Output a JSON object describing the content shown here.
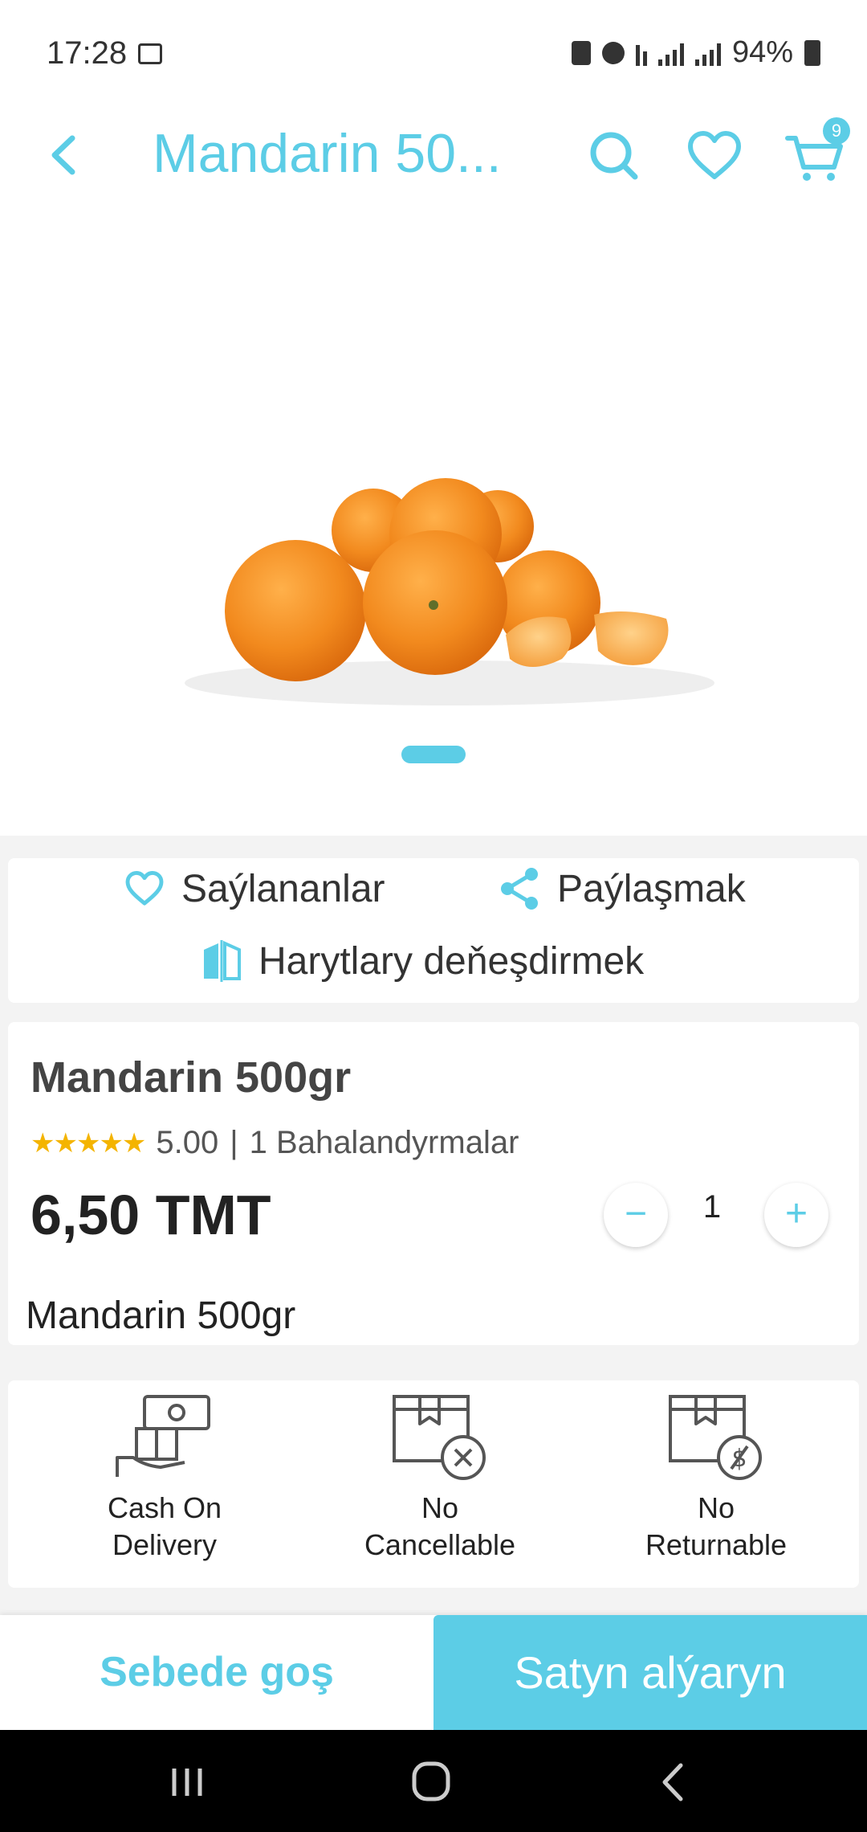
{
  "status_bar": {
    "time": "17:28",
    "battery": "94%"
  },
  "header": {
    "title": "Mandarin 50...",
    "cart_count": "9",
    "accent_color": "#5ccde6"
  },
  "actions": {
    "favorites_label": "Saýlananlar",
    "share_label": "Paýlaşmak",
    "compare_label": "Harytlary deňeşdirmek"
  },
  "product": {
    "name": "Mandarin 500gr",
    "stars": "★★★★★",
    "rating": "5.00",
    "rating_separator": "|",
    "reviews_text": "1 Bahalandyrmalar",
    "price": "6,50 TMT",
    "quantity": "1",
    "minus_symbol": "−",
    "plus_symbol": "+",
    "description": "Mandarin 500gr"
  },
  "policies": [
    {
      "icon": "cash-on-delivery-icon",
      "line1": "Cash On",
      "line2": "Delivery"
    },
    {
      "icon": "no-cancel-box-icon",
      "line1": "No",
      "line2": "Cancellable"
    },
    {
      "icon": "no-return-box-icon",
      "line1": "No",
      "line2": "Returnable"
    }
  ],
  "bottom_bar": {
    "add_to_cart": "Sebede goş",
    "buy_now": "Satyn alýaryn"
  }
}
